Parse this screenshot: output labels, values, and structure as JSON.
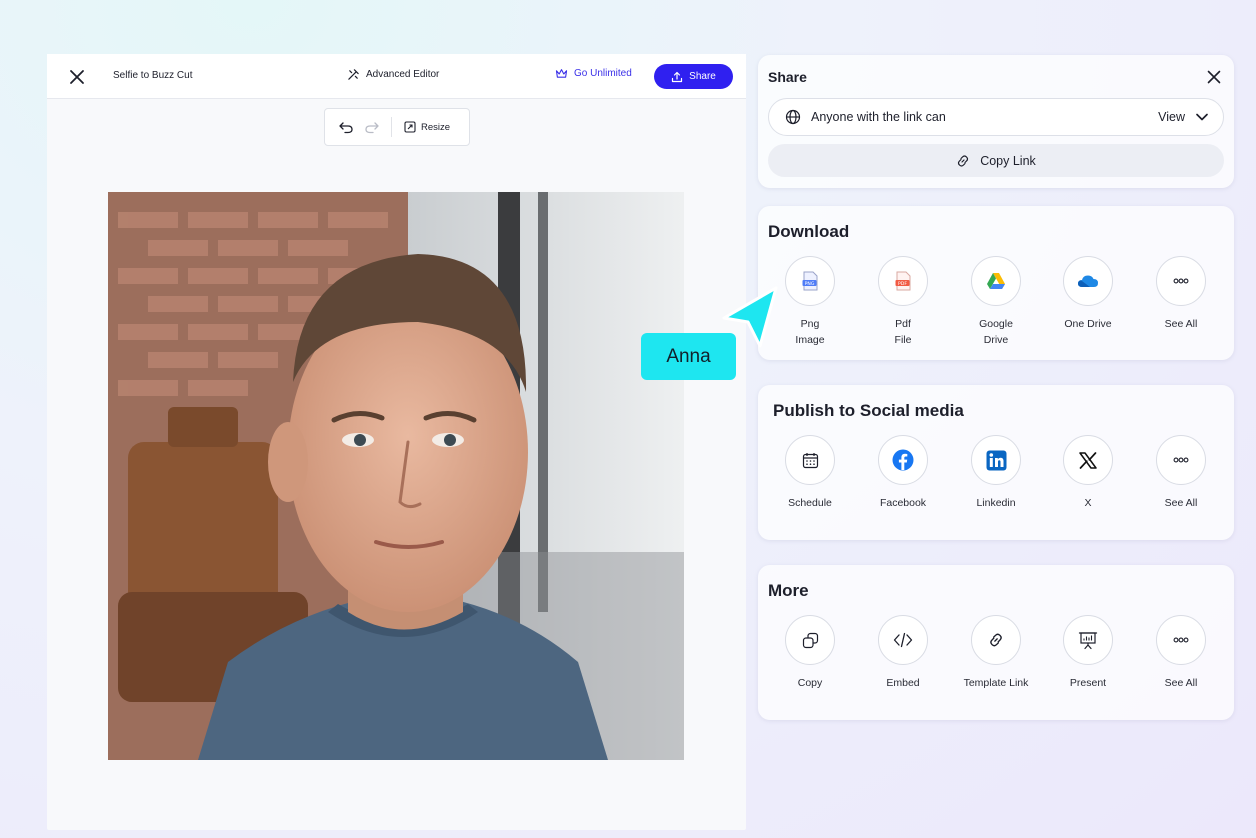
{
  "editor": {
    "doc_title": "Selfie to Buzz Cut",
    "advanced_editor_label": "Advanced Editor",
    "go_unlimited_label": "Go Unlimited",
    "share_label": "Share",
    "resize_label": "Resize",
    "icons": {
      "close": "close-icon",
      "wand": "magic-wand-icon",
      "crown": "crown-icon",
      "upload": "share-upload-icon",
      "undo": "undo-icon",
      "redo": "redo-icon",
      "resize": "resize-icon"
    }
  },
  "share": {
    "title": "Share",
    "permission_text": "Anyone with the link can",
    "permission_value": "View",
    "copy_link_label": "Copy Link"
  },
  "download": {
    "title": "Download",
    "items": [
      {
        "label": "Png\nImage",
        "icon": "png-file-icon"
      },
      {
        "label": "Pdf\nFile",
        "icon": "pdf-file-icon"
      },
      {
        "label": "Google\nDrive",
        "icon": "google-drive-icon"
      },
      {
        "label": "One Drive",
        "icon": "onedrive-icon"
      },
      {
        "label": "See All",
        "icon": "more-dots-icon"
      }
    ]
  },
  "social": {
    "title": "Publish to Social media",
    "items": [
      {
        "label": "Schedule",
        "icon": "calendar-icon"
      },
      {
        "label": "Facebook",
        "icon": "facebook-icon"
      },
      {
        "label": "Linkedin",
        "icon": "linkedin-icon"
      },
      {
        "label": "X",
        "icon": "x-logo-icon"
      },
      {
        "label": "See All",
        "icon": "more-dots-icon"
      }
    ]
  },
  "more": {
    "title": "More",
    "items": [
      {
        "label": "Copy",
        "icon": "copy-icon"
      },
      {
        "label": "Embed",
        "icon": "code-icon"
      },
      {
        "label": "Template Link",
        "icon": "link-icon"
      },
      {
        "label": "Present",
        "icon": "presentation-icon"
      },
      {
        "label": "See All",
        "icon": "more-dots-icon"
      }
    ]
  },
  "collaborator": {
    "name": "Anna",
    "color": "#1ee6f0"
  },
  "colors": {
    "accent": "#2f20f0",
    "link": "#3a30e8"
  }
}
